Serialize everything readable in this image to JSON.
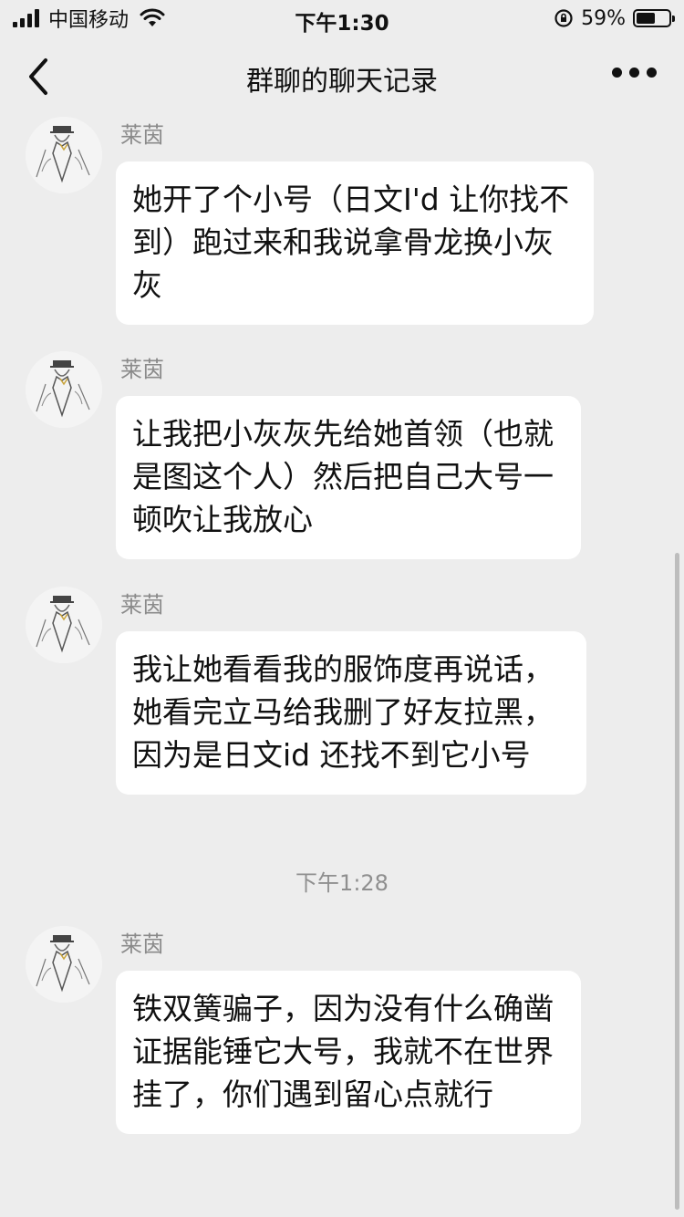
{
  "status_bar": {
    "carrier": "中国移动",
    "time": "下午1:30",
    "battery_percent": "59%",
    "battery_level": 0.59
  },
  "nav": {
    "title": "群聊的聊天记录"
  },
  "messages": [
    {
      "sender": "莱茵",
      "text": "她开了个小号（日文I'd 让你找不到）跑过来和我说拿骨龙换小灰灰"
    },
    {
      "sender": "莱茵",
      "text": "让我把小灰灰先给她首领（也就是图这个人）然后把自己大号一顿吹让我放心"
    },
    {
      "sender": "莱茵",
      "text": "我让她看看我的服饰度再说话，她看完立马给我删了好友拉黑，因为是日文id 还找不到它小号"
    },
    {
      "sender": "莱茵",
      "text": "铁双簧骗子，因为没有什么确凿证据能锤它大号，我就不在世界挂了，你们遇到留心点就行"
    }
  ],
  "time_separator": "下午1:28"
}
